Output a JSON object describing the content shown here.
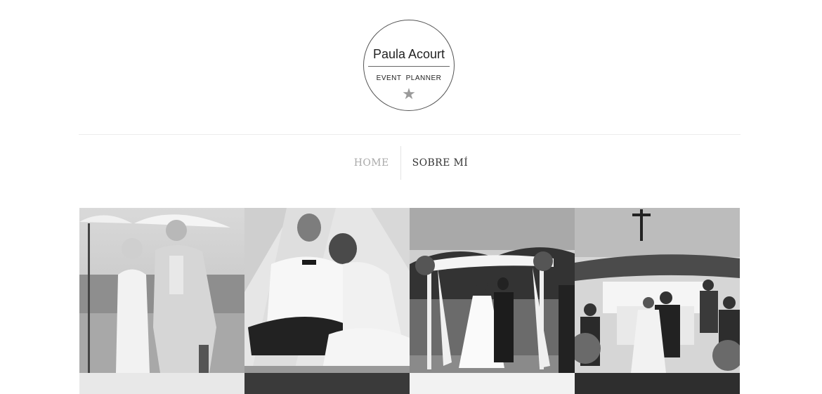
{
  "brand": {
    "name": "Paula Acourt",
    "tagline": "EVENT  PLANNER",
    "star_color": "#9a9a9a"
  },
  "nav": {
    "items": [
      {
        "label": "HOME",
        "active": true
      },
      {
        "label": "SOBRE MÍ",
        "active": false
      }
    ],
    "active_color": "#a9a9a9",
    "text_color": "#333333"
  },
  "gallery": {
    "style": "black-and-white",
    "photos": [
      {
        "subject": "couple-on-beach-photo"
      },
      {
        "subject": "couple-in-tent-photo"
      },
      {
        "subject": "outdoor-ceremony-arch-photo"
      },
      {
        "subject": "church-altar-ceremony-photo"
      }
    ]
  }
}
